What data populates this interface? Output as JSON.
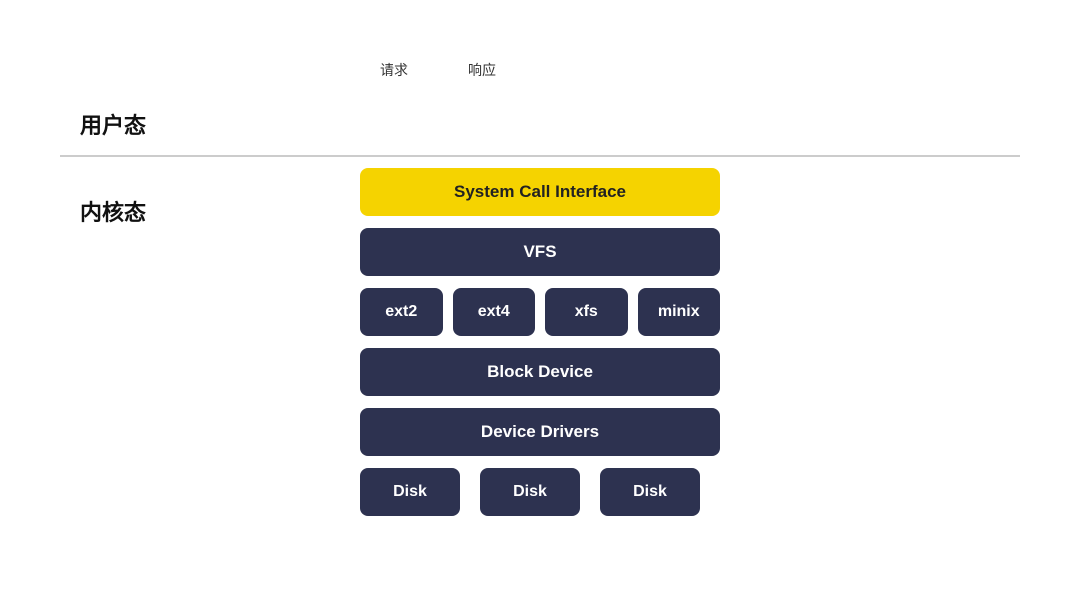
{
  "userState": {
    "label": "用户态",
    "request": "请求",
    "response": "响应"
  },
  "kernelState": {
    "label": "内核态"
  },
  "diagram": {
    "systemCallInterface": "System Call Interface",
    "vfs": "VFS",
    "filesystems": [
      "ext2",
      "ext4",
      "xfs",
      "minix"
    ],
    "blockDevice": "Block Device",
    "deviceDrivers": "Device Drivers",
    "disks": [
      "Disk",
      "Disk",
      "Disk"
    ]
  }
}
